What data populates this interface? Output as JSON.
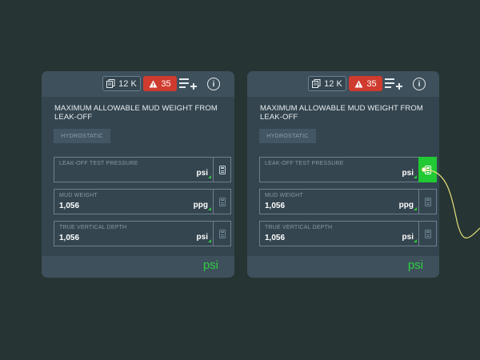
{
  "cards": [
    {
      "doc_count": "12 K",
      "alert_count": "35",
      "title": "MAXIMUM ALLOWABLE MUD WEIGHT FROM LEAK-OFF",
      "tag": "HYDROSTATIC",
      "fields": [
        {
          "label": "LEAK-OFF TEST PRESSURE",
          "value": "",
          "unit": "psi"
        },
        {
          "label": "MUD WEIGHT",
          "value": "1,056",
          "unit": "ppg"
        },
        {
          "label": "TRUE VERTICAL DEPTH",
          "value": "1,056",
          "unit": "psi"
        }
      ],
      "result_unit": "psi"
    },
    {
      "doc_count": "12 K",
      "alert_count": "35",
      "title": "MAXIMUM ALLOWABLE MUD WEIGHT FROM LEAK-OFF",
      "tag": "HYDROSTATIC",
      "fields": [
        {
          "label": "LEAK-OFF TEST PRESSURE",
          "value": "",
          "unit": "psi"
        },
        {
          "label": "MUD WEIGHT",
          "value": "1,056",
          "unit": "ppg"
        },
        {
          "label": "TRUE VERTICAL DEPTH",
          "value": "1,056",
          "unit": "psi"
        }
      ],
      "result_unit": "psi"
    }
  ],
  "icons": {
    "documents": "documents-icon",
    "alert": "warning-icon",
    "add_list": "add-list-icon",
    "info": "info-icon",
    "calculator": "calculator-icon"
  },
  "colors": {
    "background": "#263533",
    "card": "#34454f",
    "alert": "#cf3b2e",
    "accent_green": "#21c934",
    "connector": "#e6e07a"
  }
}
